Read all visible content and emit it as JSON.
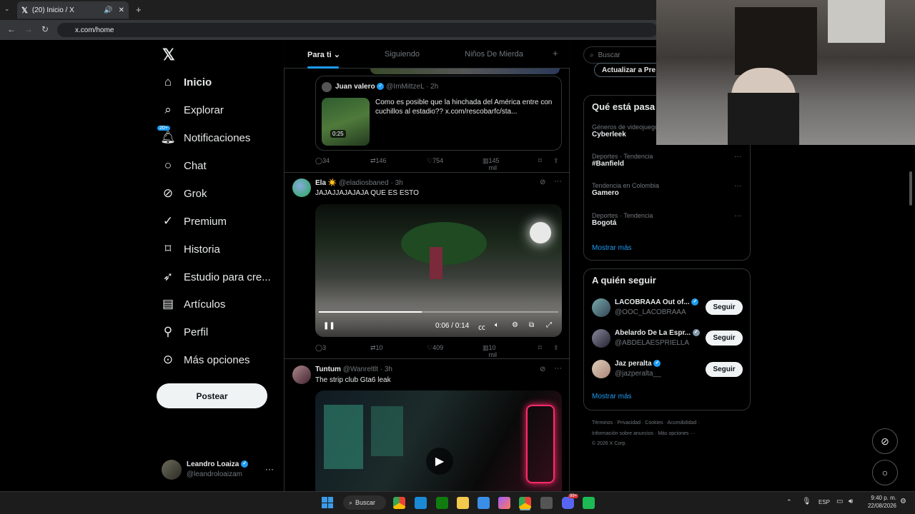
{
  "browser": {
    "tab_title": "(20) Inicio / X",
    "url": "x.com/home"
  },
  "nav": {
    "items": [
      {
        "label": "Inicio",
        "icon": "home-icon",
        "active": true
      },
      {
        "label": "Explorar",
        "icon": "search-icon"
      },
      {
        "label": "Notificaciones",
        "icon": "bell-icon",
        "badge": "20+"
      },
      {
        "label": "Chat",
        "icon": "chat-icon"
      },
      {
        "label": "Grok",
        "icon": "grok-icon"
      },
      {
        "label": "Premium",
        "icon": "premium-icon"
      },
      {
        "label": "Historia",
        "icon": "bookmark-icon"
      },
      {
        "label": "Estudio para cre...",
        "icon": "rocket-icon"
      },
      {
        "label": "Artículos",
        "icon": "article-icon"
      },
      {
        "label": "Perfil",
        "icon": "person-icon"
      },
      {
        "label": "Más opciones",
        "icon": "more-circle-icon"
      }
    ],
    "post_label": "Postear",
    "user": {
      "name": "Leandro Loaiza",
      "handle": "@leandroloaizam"
    }
  },
  "feed": {
    "tabs": [
      {
        "label": "Para ti"
      },
      {
        "label": "Siguiendo"
      },
      {
        "label": "Niños De Mierda"
      }
    ],
    "tweet1": {
      "quote_name": "Juan valero",
      "quote_handle": "@ImMittzeL",
      "quote_time": "· 2h",
      "quote_text": "Como es posible que la hinchada del América entre con cuchillos al estadio??  x.com/rescobarfc/sta...",
      "video_time": "0:25",
      "replies": "34",
      "retweets": "146",
      "likes": "754",
      "views": "145 mil"
    },
    "tweet2": {
      "name": "Ela ☀️",
      "handle": "@eladiosbaned",
      "time": "· 3h",
      "text": "JAJAJJAJAJAJA QUE ES ESTO",
      "video_time": "0:06 / 0:14",
      "progress": 0.43,
      "replies": "3",
      "retweets": "10",
      "likes": "409",
      "views": "10 mil"
    },
    "tweet3": {
      "name": "Tuntum",
      "handle": "@Wanreltlt",
      "time": "· 3h",
      "text": "The strip club Gta6 leak"
    }
  },
  "right": {
    "search_placeholder": "Buscar",
    "premium_btn": "Actualizar a Pre",
    "trends_title": "Qué está pasa",
    "trends": [
      {
        "category": "Géneros de videojuego",
        "name": "Cyberleek"
      },
      {
        "category": "Deportes · Tendencia",
        "name": "#Banfield"
      },
      {
        "category": "Tendencia en Colombia",
        "name": "Gamero"
      },
      {
        "category": "Deportes · Tendencia",
        "name": "Bogotá"
      }
    ],
    "show_more": "Mostrar más",
    "follow_title": "A quién seguir",
    "follow": [
      {
        "name": "LACOBRAAA Out of...",
        "handle": "@OOC_LACOBRAAA"
      },
      {
        "name": "Abelardo De La Espr...",
        "handle": "@ABDELAESPRIELLA"
      },
      {
        "name": "Jaz peralta",
        "handle": "@jazperalta__"
      }
    ],
    "follow_btn": "Seguir",
    "footer1": "Términos  ·  Privacidad  ·  Cookies  ·  Accesibilidad  ·",
    "footer2": "Información sobre anuncios  ·  Más opciones ···",
    "footer3": "© 2026 X Corp."
  },
  "taskbar": {
    "search": "Buscar",
    "lang": "ESP",
    "time": "9:40 p. m.",
    "date": "22/08/2026",
    "badge": "99+"
  }
}
